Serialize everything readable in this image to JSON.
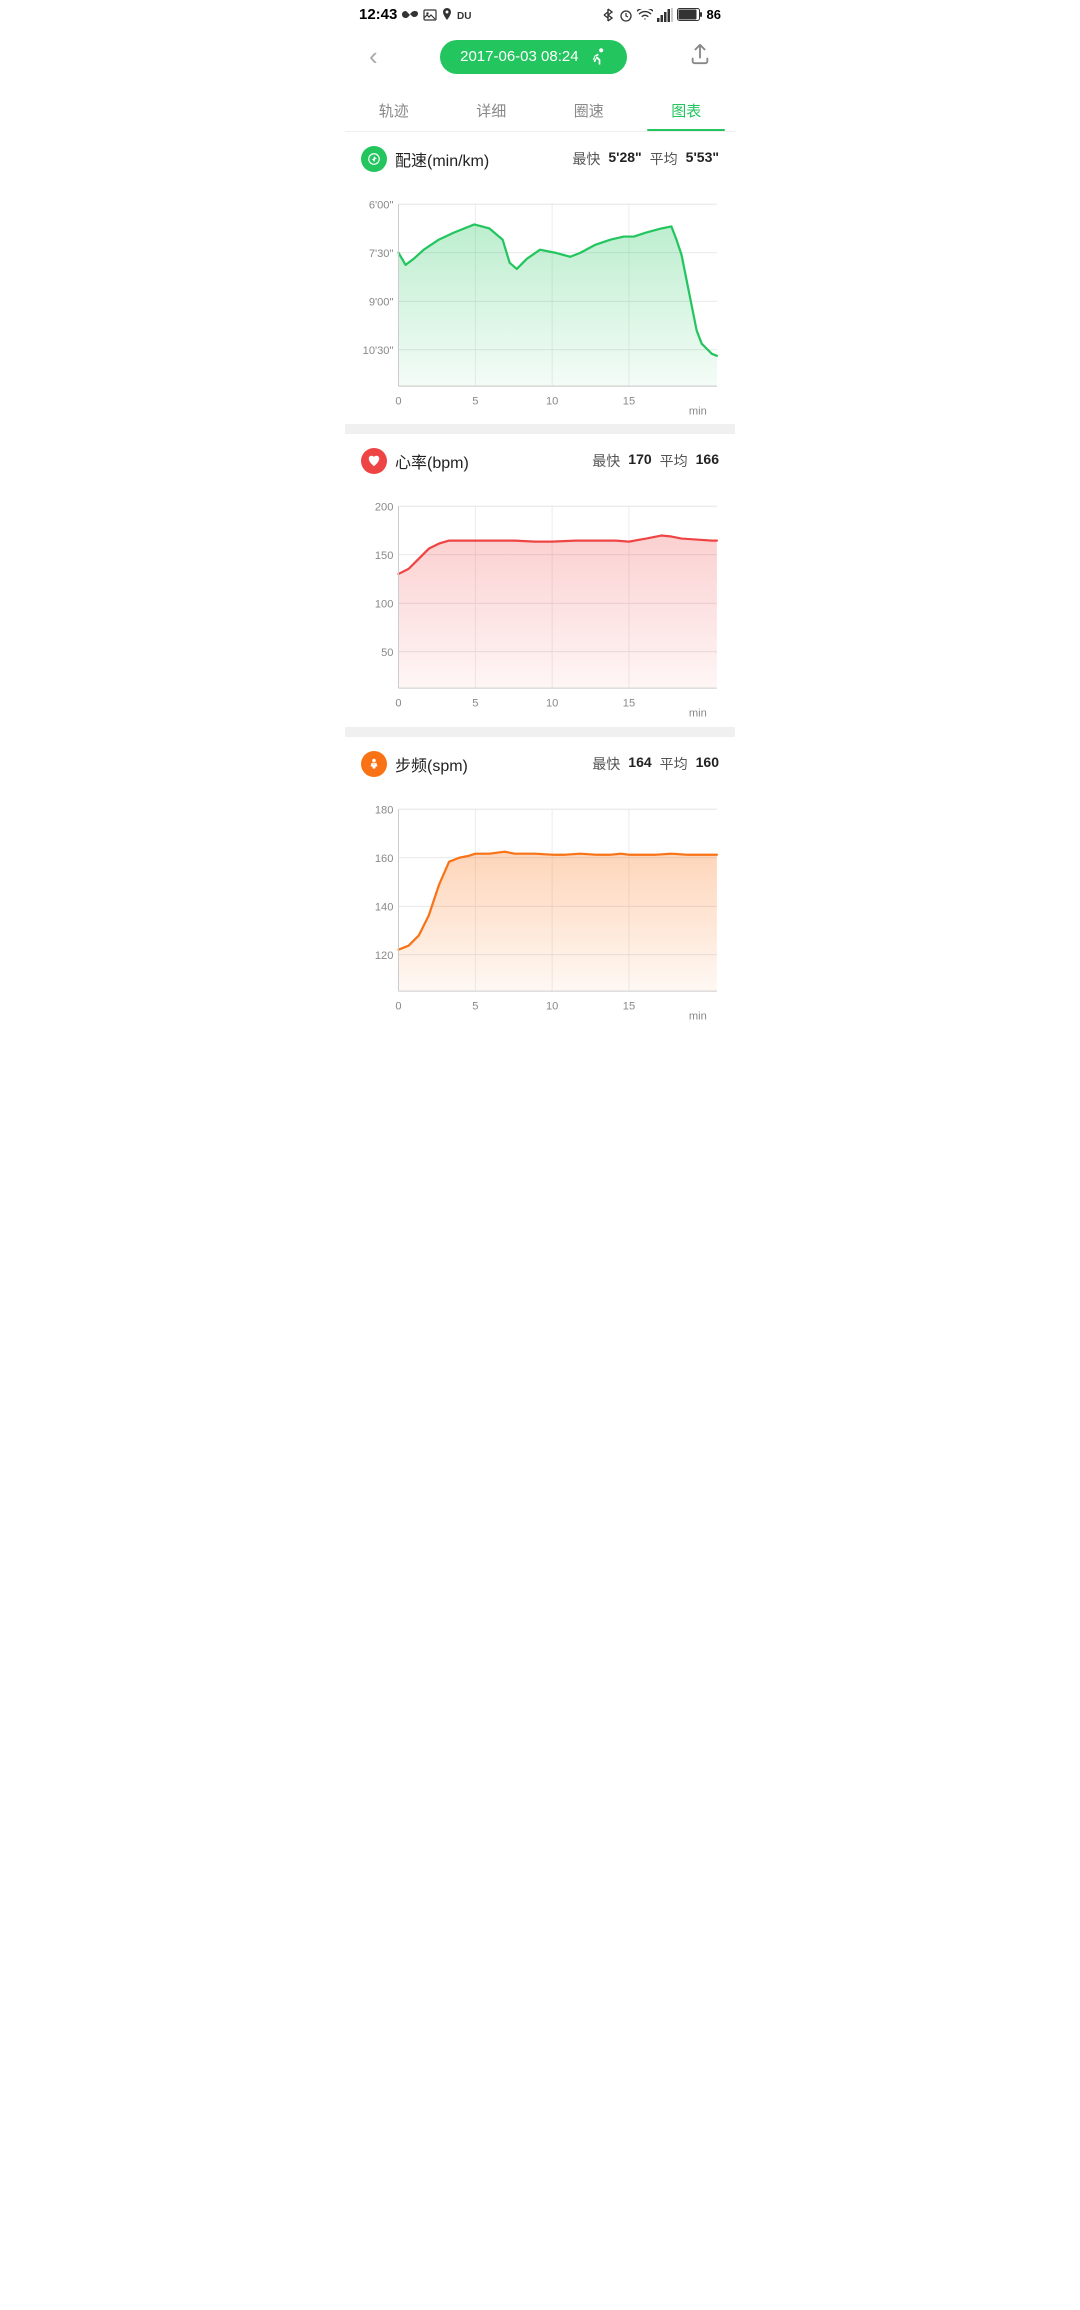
{
  "statusBar": {
    "time": "12:43",
    "battery": "86"
  },
  "header": {
    "backLabel": "‹",
    "titleDate": "2017-06-03 08:24",
    "shareLabel": "⬆"
  },
  "tabs": [
    {
      "label": "轨迹",
      "active": false
    },
    {
      "label": "详细",
      "active": false
    },
    {
      "label": "圈速",
      "active": false
    },
    {
      "label": "图表",
      "active": true
    }
  ],
  "paceChart": {
    "title": "配速(min/km)",
    "fastLabel": "最快",
    "fastValue": "5'28\"",
    "avgLabel": "平均",
    "avgValue": "5'53\"",
    "yLabels": [
      "6'00\"",
      "7'30\"",
      "9'00\"",
      "10'30\""
    ],
    "xLabels": [
      "0",
      "5",
      "10",
      "15"
    ],
    "xUnit": "min"
  },
  "heartChart": {
    "title": "心率(bpm)",
    "fastLabel": "最快",
    "fastValue": "170",
    "avgLabel": "平均",
    "avgValue": "166",
    "yLabels": [
      "200",
      "150",
      "100",
      "50"
    ],
    "xLabels": [
      "0",
      "5",
      "10",
      "15"
    ],
    "xUnit": "min"
  },
  "cadenceChart": {
    "title": "步频(spm)",
    "fastLabel": "最快",
    "fastValue": "164",
    "avgLabel": "平均",
    "avgValue": "160",
    "yLabels": [
      "180",
      "160",
      "140",
      "120"
    ],
    "xLabels": [
      "0",
      "5",
      "10",
      "15"
    ],
    "xUnit": "min"
  }
}
